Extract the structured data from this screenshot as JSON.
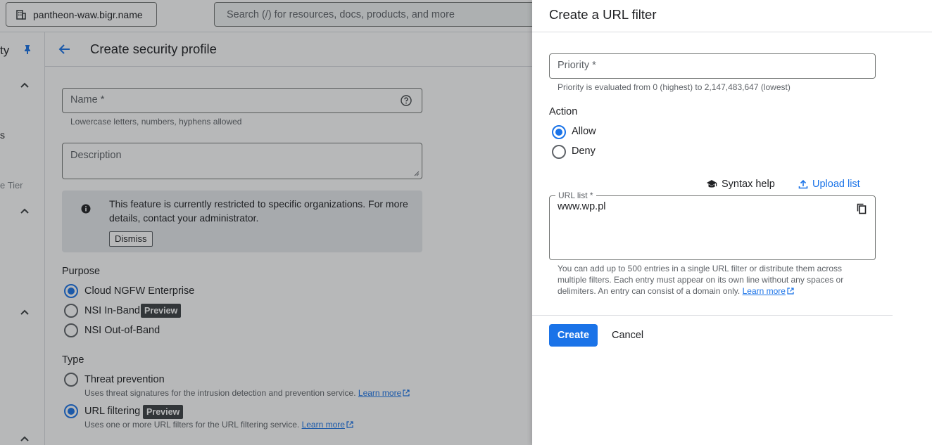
{
  "topbar": {
    "project_name": "pantheon-waw.bigr.name",
    "search_placeholder": "Search (/) for resources, docs, products, and more"
  },
  "leftnav": {
    "fragments": [
      "ty",
      "s",
      "e Tier"
    ]
  },
  "page": {
    "title": "Create security profile",
    "name_placeholder": "Name *",
    "name_hint": "Lowercase letters, numbers, hyphens allowed",
    "description_placeholder": "Description",
    "info_text": "This feature is currently restricted to specific organizations. For more details, contact your administrator.",
    "dismiss_label": "Dismiss",
    "purpose_label": "Purpose",
    "purpose_options": [
      {
        "label": "Cloud NGFW Enterprise",
        "selected": true,
        "badge": ""
      },
      {
        "label": "NSI In-Band",
        "selected": false,
        "badge": "Preview"
      },
      {
        "label": "NSI Out-of-Band",
        "selected": false,
        "badge": ""
      }
    ],
    "type_label": "Type",
    "type_options": [
      {
        "label": "Threat prevention",
        "selected": false,
        "badge": "",
        "desc": "Uses threat signatures for the intrusion detection and prevention service.",
        "link": "Learn more"
      },
      {
        "label": "URL filtering",
        "selected": true,
        "badge": "Preview",
        "desc": "Uses one or more URL filters for the URL filtering service.",
        "link": "Learn more"
      }
    ]
  },
  "panel": {
    "title": "Create a URL filter",
    "priority_placeholder": "Priority *",
    "priority_hint": "Priority is evaluated from 0 (highest) to 2,147,483,647 (lowest)",
    "action_label": "Action",
    "action_options": [
      {
        "label": "Allow",
        "selected": true
      },
      {
        "label": "Deny",
        "selected": false
      }
    ],
    "syntax_help_label": "Syntax help",
    "upload_list_label": "Upload list",
    "url_list_label": "URL list *",
    "url_list_value": "www.wp.pl",
    "url_hint": "You can add up to 500 entries in a single URL filter or distribute them across multiple filters. Each entry must appear on its own line without any spaces or delimiters. An entry can consist of a domain only.",
    "url_hint_link": "Learn more",
    "create_label": "Create",
    "cancel_label": "Cancel"
  },
  "colors": {
    "accent": "#1a73e8",
    "scrim": "rgba(32,33,36,0.32)",
    "badge_bg": "#3c4043"
  }
}
